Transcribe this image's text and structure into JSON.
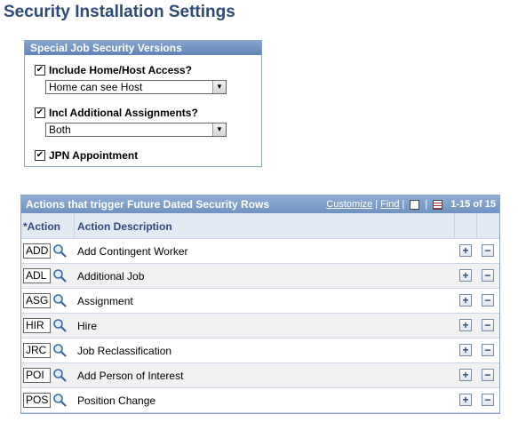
{
  "page": {
    "title": "Security Installation Settings"
  },
  "groupbox": {
    "title": "Special Job Security Versions",
    "home_host": {
      "checked": true,
      "label": "Include Home/Host Access?",
      "select_value": "Home can see Host"
    },
    "additional": {
      "checked": true,
      "label": "Incl Additional Assignments?",
      "select_value": "Both"
    },
    "jpn": {
      "checked": true,
      "label": "JPN Appointment"
    }
  },
  "grid": {
    "title": "Actions that trigger Future Dated Security Rows",
    "customize": "Customize",
    "separator": "|",
    "find": "Find",
    "count": "1-15 of 15",
    "col_action": "*Action",
    "col_description": "Action Description",
    "rows": [
      {
        "code": "ADD",
        "description": "Add Contingent Worker"
      },
      {
        "code": "ADL",
        "description": "Additional Job"
      },
      {
        "code": "ASG",
        "description": "Assignment"
      },
      {
        "code": "HIR",
        "description": "Hire"
      },
      {
        "code": "JRC",
        "description": "Job Reclassification"
      },
      {
        "code": "POI",
        "description": "Add Person of Interest"
      },
      {
        "code": "POS",
        "description": "Position Change"
      }
    ],
    "add_symbol": "+",
    "delete_symbol": "−"
  },
  "icons": {
    "check": "✔",
    "lookup": "magnifier-icon",
    "chevron": "▼"
  }
}
